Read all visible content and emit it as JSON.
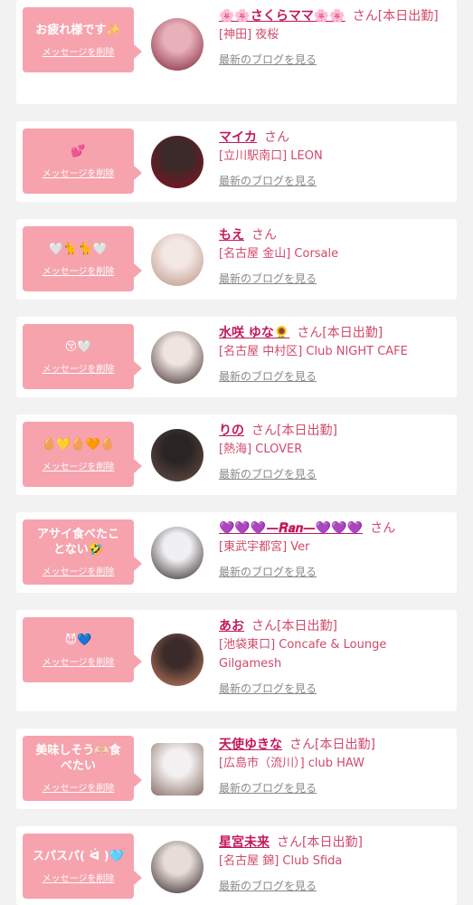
{
  "cards": [
    {
      "message": "お疲れ様です✨",
      "delete_label": "メッセージを削除",
      "name": "🌸🌸さくらママ🌸🌸",
      "suffix": "さん[本日出勤]",
      "shop": "[神田] 夜桜",
      "blog_label": "最新のブログを見る",
      "avatar_colors": [
        "#e8b0b8",
        "#7a2038"
      ]
    },
    {
      "message": "💕",
      "delete_label": "メッセージを削除",
      "name": "マイカ",
      "suffix": "さん",
      "shop": "[立川駅南口] LEON",
      "blog_label": "最新のブログを見る",
      "avatar_colors": [
        "#3a2a2a",
        "#8a1020"
      ]
    },
    {
      "message": "🤍🐈🐈🤍",
      "delete_label": "メッセージを削除",
      "name": "もえ",
      "suffix": "さん",
      "shop": "[名古屋 金山] Corsale",
      "blog_label": "最新のブログを見る",
      "avatar_colors": [
        "#f4e8e4",
        "#b89080"
      ]
    },
    {
      "message": "😚🤍",
      "delete_label": "メッセージを削除",
      "name": "水咲 ゆな🌻",
      "suffix": "さん[本日出勤]",
      "shop": "[名古屋 中村区] Club NIGHT CAFE",
      "blog_label": "最新のブログを見る",
      "avatar_colors": [
        "#efe4e0",
        "#3a2a28"
      ]
    },
    {
      "message": "🥚💛🥚🧡🥚",
      "delete_label": "メッセージを削除",
      "name": "りの",
      "suffix": "さん[本日出勤]",
      "shop": "[熱海] CLOVER",
      "blog_label": "最新のブログを見る",
      "avatar_colors": [
        "#2a2424",
        "#6a5048"
      ]
    },
    {
      "message": "アサイ食べたことない🤣",
      "delete_label": "メッセージを削除",
      "name": "💜💜💜—𝑹𝒂𝒏—💜💜💜",
      "suffix": "さん",
      "shop": "[東武宇都宮] Ver",
      "blog_label": "最新のブログを見る",
      "avatar_colors": [
        "#f0f0f2",
        "#2a2020"
      ]
    },
    {
      "message": "😈💙",
      "delete_label": "メッセージを削除",
      "name": "あお",
      "suffix": "さん[本日出勤]",
      "shop": "[池袋東口] Concafe & Lounge Gilgamesh",
      "blog_label": "最新のブログを見る",
      "avatar_colors": [
        "#3a2a2a",
        "#c88060"
      ]
    },
    {
      "message": "美味しそう🫶🏻食べたい",
      "delete_label": "メッセージを削除",
      "name": "天使ゆきな",
      "suffix": "さん[本日出勤]",
      "shop": "[広島市（流川）] club HAW",
      "blog_label": "最新のブログを見る",
      "avatar_colors": [
        "#f2f0f0",
        "#8a7068"
      ]
    },
    {
      "message": "スパスパ( ᐛ )🩵",
      "delete_label": "メッセージを削除",
      "name": "星宮未来",
      "suffix": "さん[本日出勤]",
      "shop": "[名古屋 錦] Club Sfida",
      "blog_label": "最新のブログを見る",
      "avatar_colors": [
        "#e8dcd8",
        "#2a2020"
      ]
    }
  ]
}
